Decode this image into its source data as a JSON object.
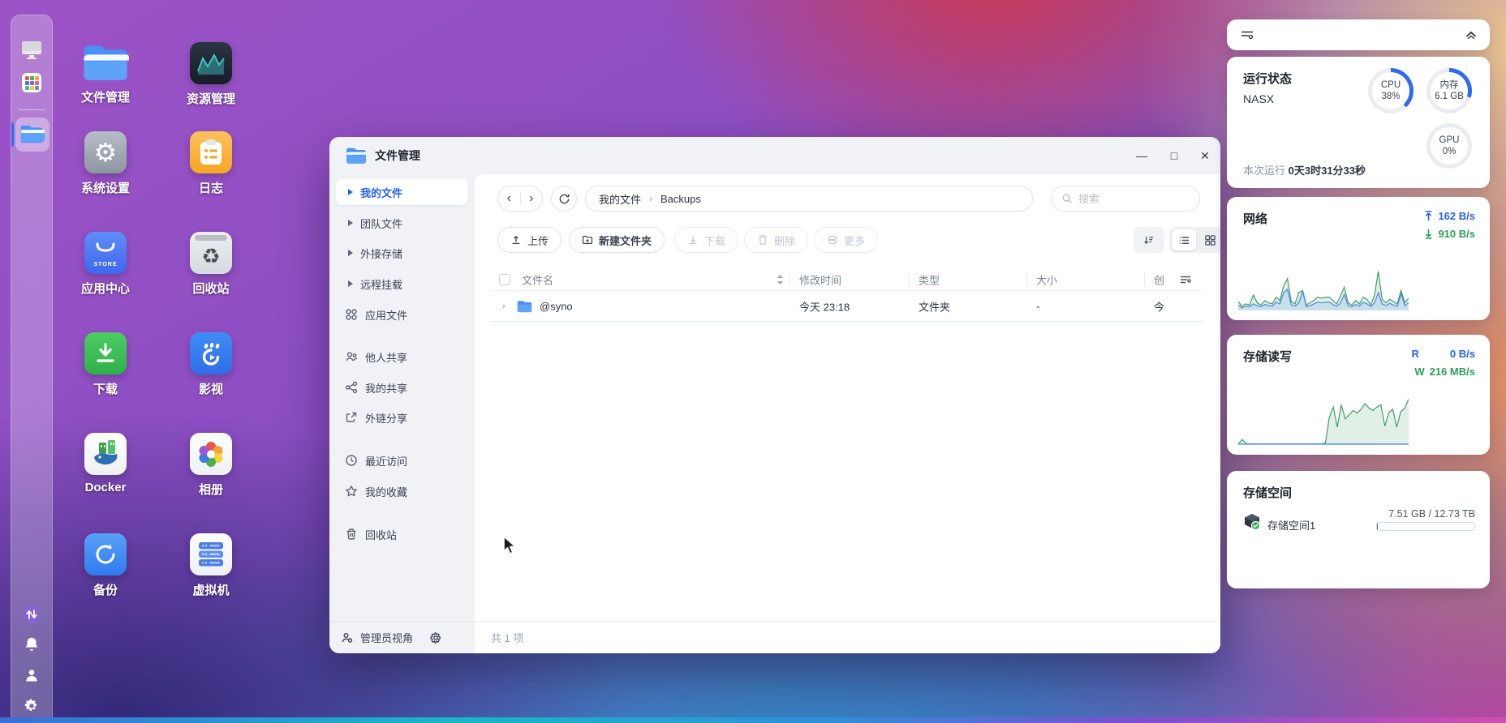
{
  "colors": {
    "accent": "#2f6bef",
    "chart_up": "#4a86f0",
    "chart_down": "#3fa065",
    "ring_track": "#e9ecf1"
  },
  "desktop": {
    "taskbar": {
      "items": [
        "desktop-switcher",
        "app-launcher",
        "file-manager-active"
      ],
      "bottom": [
        "transfer",
        "notifications",
        "user",
        "settings"
      ]
    },
    "icons": [
      {
        "label": "文件管理"
      },
      {
        "label": "资源管理"
      },
      {
        "label": "系统设置"
      },
      {
        "label": "日志"
      },
      {
        "label": "应用中心",
        "icon_text": "STORE"
      },
      {
        "label": "回收站"
      },
      {
        "label": "下载"
      },
      {
        "label": "影视"
      },
      {
        "label": "Docker"
      },
      {
        "label": "相册"
      },
      {
        "label": "备份"
      },
      {
        "label": "虚拟机"
      }
    ]
  },
  "window": {
    "title": "文件管理",
    "controls": {
      "minimize": "—",
      "maximize": "□",
      "close": "✕"
    },
    "sidebar": {
      "items": [
        {
          "label": "我的文件"
        },
        {
          "label": "团队文件"
        },
        {
          "label": "外接存储"
        },
        {
          "label": "远程挂载"
        },
        {
          "label": "应用文件"
        },
        {
          "label": "他人共享"
        },
        {
          "label": "我的共享"
        },
        {
          "label": "外链分享"
        },
        {
          "label": "最近访问"
        },
        {
          "label": "我的收藏"
        },
        {
          "label": "回收站"
        }
      ]
    },
    "sidebar_footer": {
      "role": "管理员视角"
    },
    "nav": {
      "breadcrumb": [
        "我的文件",
        "Backups"
      ],
      "separator": "›",
      "search_placeholder": "搜索"
    },
    "toolbar": {
      "upload": "上传",
      "new_folder": "新建文件夹",
      "download": "下载",
      "delete": "删除",
      "more": "更多"
    },
    "table": {
      "headers": {
        "name": "文件名",
        "modified": "修改时间",
        "type": "类型",
        "size": "大小",
        "created": "创"
      },
      "rows": [
        {
          "name": "@syno",
          "modified": "今天 23:18",
          "type": "文件夹",
          "size": "-",
          "created": "今"
        }
      ]
    },
    "status": "共 1 项"
  },
  "panel": {
    "status": {
      "title": "运行状态",
      "host": "NASX",
      "cpu": {
        "label": "CPU",
        "value": "38%",
        "percent": 38
      },
      "memory": {
        "label": "内存",
        "value": "6.1 GB",
        "percent": 30
      },
      "gpu": {
        "label": "GPU",
        "value": "0%",
        "percent": 0
      },
      "uptime_label": "本次运行",
      "uptime": "0天3时31分33秒"
    },
    "network": {
      "title": "网络",
      "up": "162 B/s",
      "down": "910 B/s"
    },
    "disk": {
      "title": "存储读写",
      "read_label": "R",
      "read": "0 B/s",
      "write_label": "W",
      "write": "216 MB/s"
    },
    "storage": {
      "title": "存储空间",
      "volume": "存储空间1",
      "usage": "7.51 GB / 12.73 TB",
      "percent": 0.6
    }
  },
  "chart_data": [
    {
      "id": "network",
      "type": "area",
      "title": "网络",
      "legend_position": "top-right",
      "grid": false,
      "x": "rolling time window (unlabeled)",
      "ylim": [
        0,
        100
      ],
      "series": [
        {
          "name": "下载",
          "color": "#3fa065",
          "values": [
            14,
            6,
            10,
            8,
            26,
            12,
            8,
            16,
            12,
            10,
            22,
            16,
            42,
            55,
            14,
            10,
            30,
            34,
            8,
            12,
            16,
            22,
            20,
            22,
            22,
            16,
            10,
            24,
            40,
            12,
            8,
            16,
            10,
            22,
            18,
            8,
            26,
            68,
            18,
            12,
            18,
            14,
            10,
            34,
            12,
            20
          ]
        },
        {
          "name": "上传",
          "color": "#4a86f0",
          "values": [
            8,
            3,
            6,
            5,
            10,
            7,
            5,
            9,
            7,
            6,
            13,
            10,
            30,
            36,
            8,
            6,
            12,
            32,
            5,
            7,
            10,
            13,
            12,
            13,
            13,
            9,
            6,
            11,
            27,
            7,
            5,
            9,
            6,
            13,
            10,
            5,
            12,
            30,
            10,
            7,
            11,
            8,
            6,
            28,
            7,
            12
          ]
        }
      ]
    },
    {
      "id": "disk",
      "type": "area",
      "title": "存储读写",
      "legend_position": "top-right",
      "grid": false,
      "x": "rolling time window (unlabeled)",
      "ylim": [
        0,
        100
      ],
      "series": [
        {
          "name": "写",
          "color": "#3fa065",
          "values": [
            0,
            8,
            1,
            0,
            0,
            0,
            0,
            0,
            0,
            0,
            0,
            0,
            0,
            0,
            0,
            0,
            0,
            0,
            0,
            0,
            0,
            0,
            2,
            48,
            66,
            30,
            70,
            45,
            52,
            60,
            55,
            62,
            72,
            64,
            60,
            66,
            70,
            32,
            56,
            62,
            30,
            58,
            64,
            80
          ]
        },
        {
          "name": "读",
          "color": "#4a86f0",
          "values": [
            0,
            0,
            0,
            0,
            0,
            0,
            0,
            0,
            0,
            0,
            0,
            0,
            0,
            0,
            0,
            0,
            0,
            0,
            0,
            0,
            0,
            0,
            0,
            0,
            0,
            0,
            0,
            0,
            0,
            0,
            0,
            0,
            0,
            0,
            0,
            0,
            0,
            0,
            0,
            0,
            0,
            0,
            0,
            0
          ]
        }
      ]
    }
  ]
}
